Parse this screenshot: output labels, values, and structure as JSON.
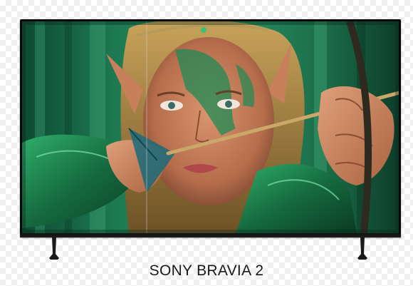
{
  "product": {
    "title": "SONY BRAVIA 2"
  },
  "tv": {
    "screen_image": "elf-archer-portrait",
    "frame_color": "#0a0a0a",
    "accent_green": "#1f8a55"
  }
}
